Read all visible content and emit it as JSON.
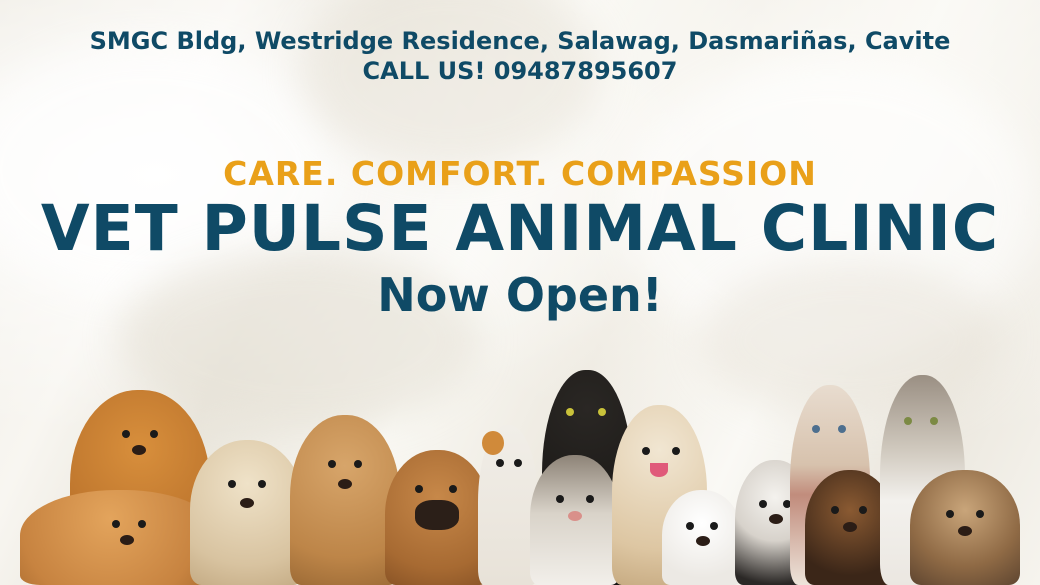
{
  "header": {
    "address": "SMGC Bldg, Westridge Residence, Salawag, Dasmariñas, Cavite",
    "phone": "CALL US! 09487895607"
  },
  "hero": {
    "tagline": "CARE. COMFORT. COMPASSION",
    "title": "VET PULSE ANIMAL CLINIC",
    "subtitle": "Now Open!"
  },
  "colors": {
    "navy": "#0f4a66",
    "gold": "#e9a019",
    "background": "#f4f1ea"
  },
  "pets": [
    "pomeranian",
    "pomeranian-puppy",
    "cocker-spaniel-cream",
    "cocker-spaniel-golden",
    "boxer",
    "calico-cat",
    "black-cat",
    "tabby-white-cat",
    "shih-tzu-tan",
    "shih-tzu-white",
    "shih-tzu-black-white",
    "siamese-cat",
    "dachshund",
    "tabby-cat",
    "shih-tzu-brown"
  ]
}
